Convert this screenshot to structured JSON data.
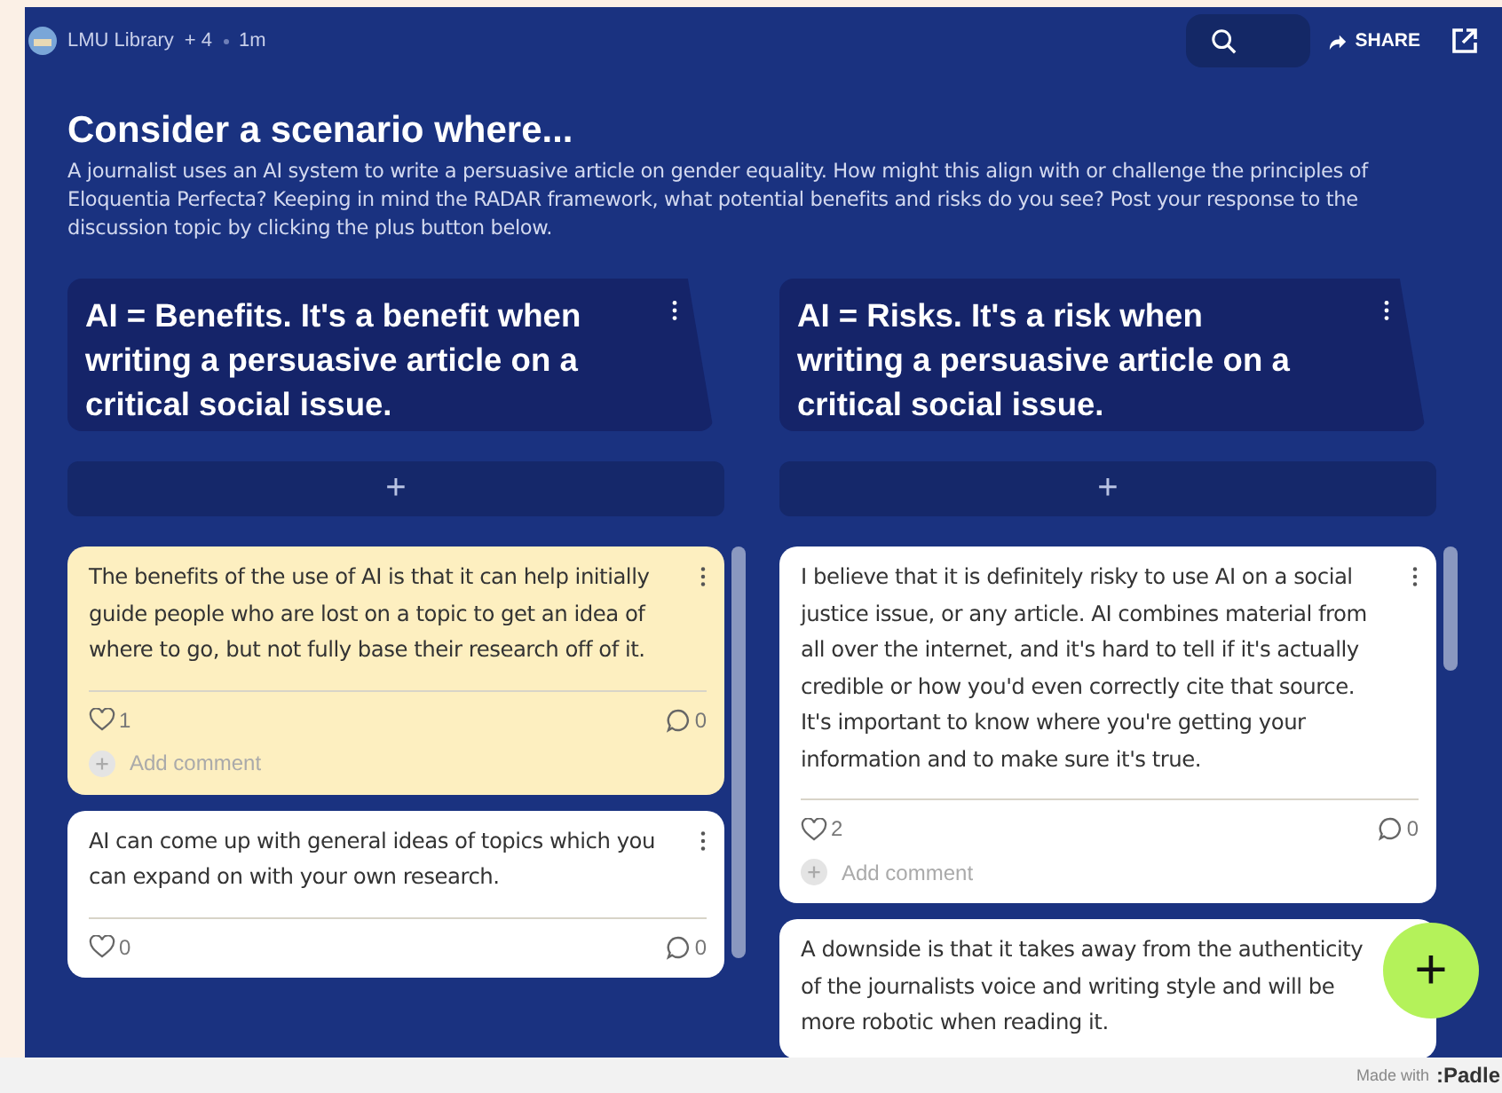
{
  "topbar": {
    "board_owner": "LMU Library",
    "contributors": "+ 4",
    "age": "1m",
    "share_label": "SHARE"
  },
  "heading": {
    "title": "Consider a scenario where...",
    "description": "A journalist uses an AI system to write a persuasive article on gender equality. How might this align with or challenge the principles of Eloquentia Perfecta? Keeping in mind the RADAR framework, what potential benefits and risks do you see? Post your response to the discussion topic by clicking the plus button below."
  },
  "columns": [
    {
      "title": "AI = Benefits. It's a benefit when writing a persuasive article on a critical social issue.",
      "add_label": "+",
      "posts": [
        {
          "text": "The benefits of the use of AI is that it can help initially guide people who are lost on a topic to get an idea of where to go, but not fully base their research off of it.",
          "color": "#fdefc0",
          "likes": "1",
          "comments": "0",
          "add_comment": "Add comment"
        },
        {
          "text": "AI can come up with general ideas of topics which you can expand on with your own research.",
          "color": "#ffffff",
          "likes": "0",
          "comments": "0"
        }
      ]
    },
    {
      "title": "AI  = Risks. It's a risk when writing a persuasive article on a critical social issue.",
      "add_label": "+",
      "posts": [
        {
          "text": "I believe that it is definitely risky to use AI on a social justice issue, or any article. AI combines material from all over the internet, and it's hard to tell if it's actually credible or how you'd even correctly cite that source. It's important to know where you're getting your information and to make sure it's true.",
          "color": "#ffffff",
          "likes": "2",
          "comments": "0",
          "add_comment": "Add comment"
        },
        {
          "text": "A downside is that it takes away from the authenticity of the journalists voice and writing style and will be more robotic when reading it.",
          "color": "#ffffff"
        }
      ]
    }
  ],
  "fab_label": "+",
  "footer": {
    "made_with": "Made with",
    "brand": ":Padle"
  }
}
